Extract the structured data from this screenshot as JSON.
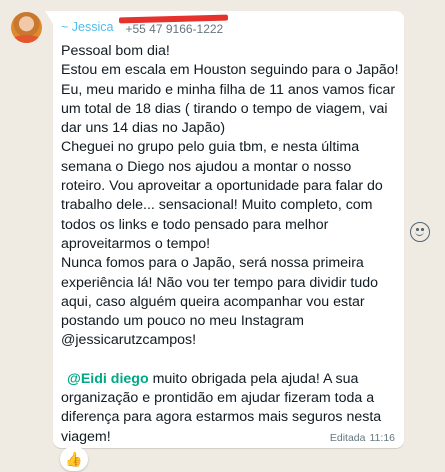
{
  "message": {
    "sender_name": "~ Jessica",
    "sender_phone": "+55 47 9166-1222",
    "paragraphs": [
      [
        "Pessoal bom dia!",
        "Estou em escala em Houston seguindo para o Japão!",
        "Eu, meu marido e minha filha de 11 anos vamos ficar",
        "um total de 18 dias ( tirando o tempo de viagem, vai",
        "dar uns 14 dias no Japão)",
        "Cheguei no grupo pelo guia tbm, e nesta última",
        "semana o Diego nos ajudou a montar o nosso",
        "roteiro. Vou aproveitar a oportunidade para falar do",
        "trabalho dele... sensacional! Muito completo, com",
        "todos os links e todo pensado para melhor",
        "aproveitarmos o tempo!",
        "Nunca fomos para o Japão, será nossa primeira",
        "experiência lá! Não vou ter tempo para dividir tudo",
        "aqui, caso alguém queira acompanhar vou estar",
        "postando um pouco no meu Instagram",
        "@jessicarutzcampos!"
      ]
    ],
    "mention": "@Eidi diego",
    "reply_first_line": " muito obrigada pela ajuda! A sua",
    "reply_lines": [
      "organização e prontidão em ajudar fizeram toda a",
      "diferença para agora estarmos mais seguros nesta",
      "viagem!"
    ],
    "edited_label": "Editada",
    "time": "11:16",
    "reaction_emoji": "👍"
  },
  "icons": {
    "emoji": "smiley-icon",
    "reaction": "thumbs-up-icon"
  },
  "colors": {
    "background": "#efeae2",
    "bubble": "#ffffff",
    "sender_name": "#53bdeb",
    "mention": "#00a884",
    "text": "#111b21",
    "meta": "#667781",
    "redaction": "#e5322d"
  }
}
